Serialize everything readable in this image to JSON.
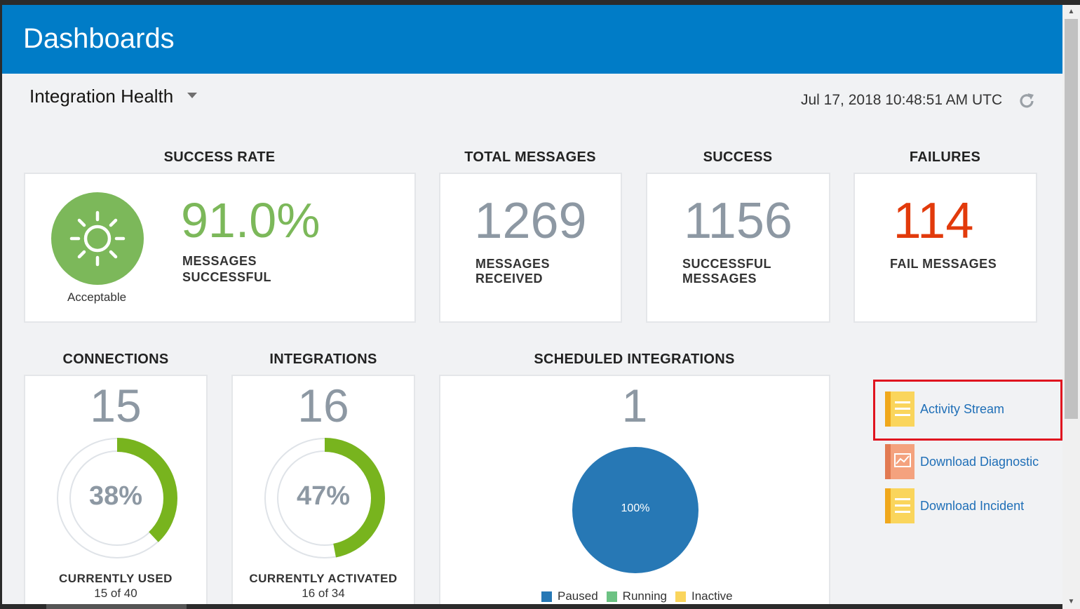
{
  "app": {
    "title": "Dashboards"
  },
  "view": {
    "selector_label": "Integration Health",
    "timestamp": "Jul 17, 2018 10:48:51 AM UTC"
  },
  "success_rate": {
    "heading": "SUCCESS RATE",
    "value": "91.0%",
    "status": "Acceptable",
    "label_line1": "MESSAGES",
    "label_line2": "SUCCESSFUL"
  },
  "total_messages": {
    "heading": "TOTAL MESSAGES",
    "value": "1269",
    "label_line1": "MESSAGES",
    "label_line2": "RECEIVED"
  },
  "success": {
    "heading": "SUCCESS",
    "value": "1156",
    "label_line1": "SUCCESSFUL",
    "label_line2": "MESSAGES"
  },
  "failures": {
    "heading": "FAILURES",
    "value": "114",
    "label": "FAIL MESSAGES"
  },
  "connections": {
    "heading": "CONNECTIONS",
    "value": "15",
    "percent_label": "38%",
    "percent": 38,
    "caption": "CURRENTLY USED",
    "detail": "15 of 40"
  },
  "integrations": {
    "heading": "INTEGRATIONS",
    "value": "16",
    "percent_label": "47%",
    "percent": 47,
    "caption": "CURRENTLY ACTIVATED",
    "detail": "16 of 34"
  },
  "scheduled": {
    "heading": "SCHEDULED INTEGRATIONS",
    "value": "1",
    "pie_label": "100%",
    "legend": [
      {
        "label": "Paused",
        "color": "#2778b5"
      },
      {
        "label": "Running",
        "color": "#6cc283"
      },
      {
        "label": "Inactive",
        "color": "#fad55c"
      }
    ]
  },
  "links": {
    "activity_stream": "Activity Stream",
    "download_diagnostic": "Download Diagnostic",
    "download_incident": "Download Incident"
  },
  "colors": {
    "header": "#007cc7",
    "success_green": "#7cb85a",
    "failure_red": "#e23a0b",
    "donut_green": "#78b41e",
    "link_blue": "#1f6fb7",
    "highlight_red": "#e0141f"
  }
}
